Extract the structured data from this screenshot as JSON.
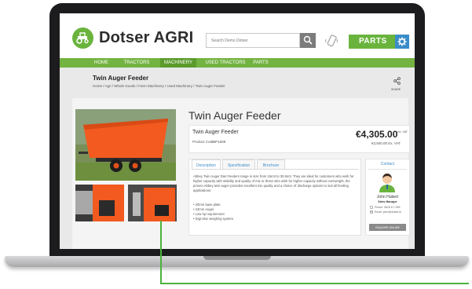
{
  "brand": {
    "name": "Dotser AGRI",
    "accent": "#6ab43e",
    "nav_color": "#73b341",
    "link_color": "#3d8bc7"
  },
  "search": {
    "placeholder": "Search Demo Dotser"
  },
  "parts_button": {
    "label": "PARTS"
  },
  "nav": {
    "items": [
      "HOME",
      "TRACTORS",
      "MACHINERY",
      "USED TRACTORS",
      "PARTS"
    ],
    "active": "MACHINERY"
  },
  "page": {
    "heading": "Twin Auger Feeder",
    "breadcrumb": "Home  /  Agri  /  Whole Goods  /  Farm Machinery  /  Used Machinery  /  Twin Auger Feeder",
    "share_label": "SHARE"
  },
  "product": {
    "title": "Twin Auger Feeder",
    "name": "Twin Auger Feeder",
    "code_label": "Product Code:",
    "code_value": "HP1508",
    "price": "€4,305.00",
    "price_note": "Inc. VAT",
    "price_ex": "€3,500.00 Ex. VAT"
  },
  "tabs": [
    {
      "label": "Description",
      "active": true
    },
    {
      "label": "Specification",
      "active": false
    },
    {
      "label": "Brochure",
      "active": false
    }
  ],
  "description": "Abbey Twin Auger Diet Feeders range in size from 15m3 to 30.5m3. They are ideal for customers who wish for higher capacity with stability and quality of mix or those who wish for higher capacity without overweight, the proven Abbey twin auger provides excellent mix quality and a choice of discharge options to suit all feeding applications.",
  "features": [
    "20mm base plate",
    "22mm Auger",
    "Low hp requirement",
    "Digi-Star weighing system"
  ],
  "contact": {
    "heading": "Contact",
    "name": "John Hubert",
    "role": "Sales Manager",
    "phone": "Phone: 0818 6 1 953",
    "email": "Email: john@dotser.ie",
    "button": "ENQUIRE ONLINE"
  },
  "icons": [
    "logo-tractor-icon",
    "search-icon",
    "phone-icon",
    "gear-icon",
    "share-icon",
    "avatar-icon",
    "phone-small-icon",
    "mail-icon"
  ]
}
